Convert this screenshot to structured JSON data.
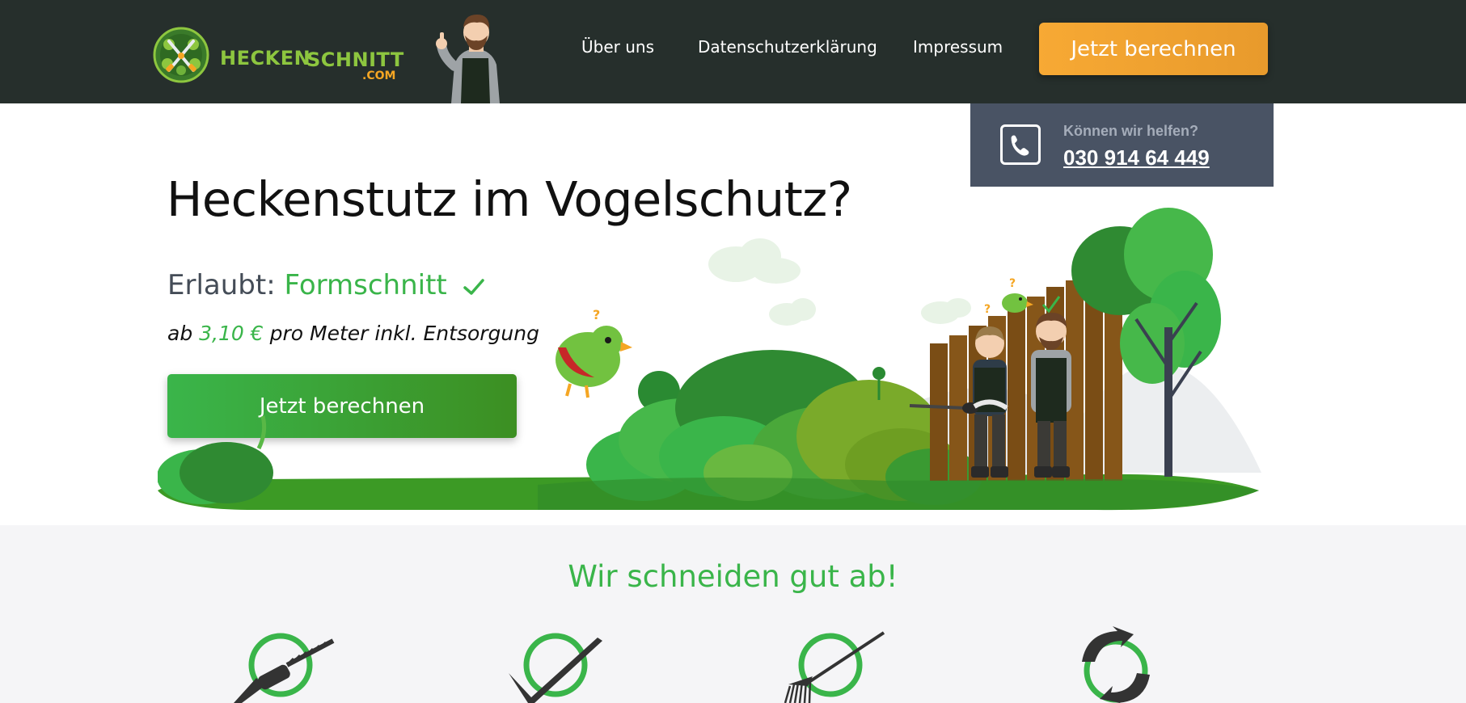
{
  "header": {
    "brand": {
      "word1": "HECKEN",
      "word2": "SCHNITT",
      "tld": ".COM"
    },
    "nav": [
      "Über uns",
      "Datenschutzerklärung",
      "Impressum"
    ],
    "cta_label": "Jetzt berechnen"
  },
  "help": {
    "question": "Können wir helfen?",
    "phone": "030 914 64 449"
  },
  "hero": {
    "title": "Heckenstutz im Vogelschutz?",
    "allowed_label": "Erlaubt:",
    "allowed_value": "Formschnitt",
    "price_prefix": "ab",
    "price_value": "3,10 €",
    "price_suffix": "pro Meter inkl. Entsorgung",
    "cta_label": "Jetzt berechnen"
  },
  "services": {
    "title": "Wir schneiden gut ab!"
  },
  "icons": {
    "logo": "hedge-shears-logo-icon",
    "phone": "phone-icon",
    "check": "checkmark-icon",
    "services": [
      "hedge-trimmer-icon",
      "sickle-icon",
      "rake-icon",
      "recycle-icon"
    ]
  },
  "colors": {
    "header_bg": "#262f2c",
    "accent_green": "#3ab54a",
    "accent_orange": "#f7a934",
    "help_bg": "#495364",
    "section_bg": "#f5f5f7"
  }
}
